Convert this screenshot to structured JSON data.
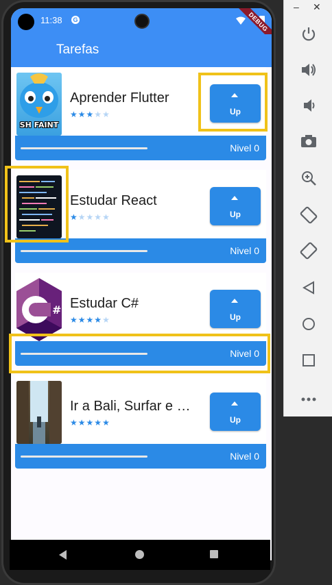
{
  "status_bar": {
    "time": "11:38",
    "debug_label": "DEBUG"
  },
  "app_bar": {
    "title": "Tarefas"
  },
  "tasks": [
    {
      "name": "Aprender Flutter",
      "difficulty": 3,
      "level_label": "Nivel 0",
      "progress": 0,
      "up_label": "Up",
      "thumb_text": "SH FAINT"
    },
    {
      "name": "Estudar React",
      "difficulty": 1,
      "level_label": "Nivel 0",
      "progress": 0,
      "up_label": "Up"
    },
    {
      "name": "Estudar C#",
      "difficulty": 4,
      "level_label": "Nivel 0",
      "progress": 0,
      "up_label": "Up"
    },
    {
      "name": "Ir a Bali, Surfar e Meditar",
      "difficulty": 5,
      "level_label": "Nivel 0",
      "progress": 0,
      "up_label": "Up"
    }
  ],
  "emulator_panel": {
    "window_controls": [
      "–",
      "✕"
    ],
    "buttons": [
      "power-icon",
      "volume-up-icon",
      "volume-down-icon",
      "camera-icon",
      "zoom-icon",
      "rotate-left-icon",
      "rotate-right-icon",
      "back-icon",
      "home-icon",
      "overview-icon",
      "more-icon"
    ]
  },
  "colors": {
    "primary": "#3d8ef5",
    "button": "#2b8ae6",
    "highlight": "#f0c219"
  }
}
